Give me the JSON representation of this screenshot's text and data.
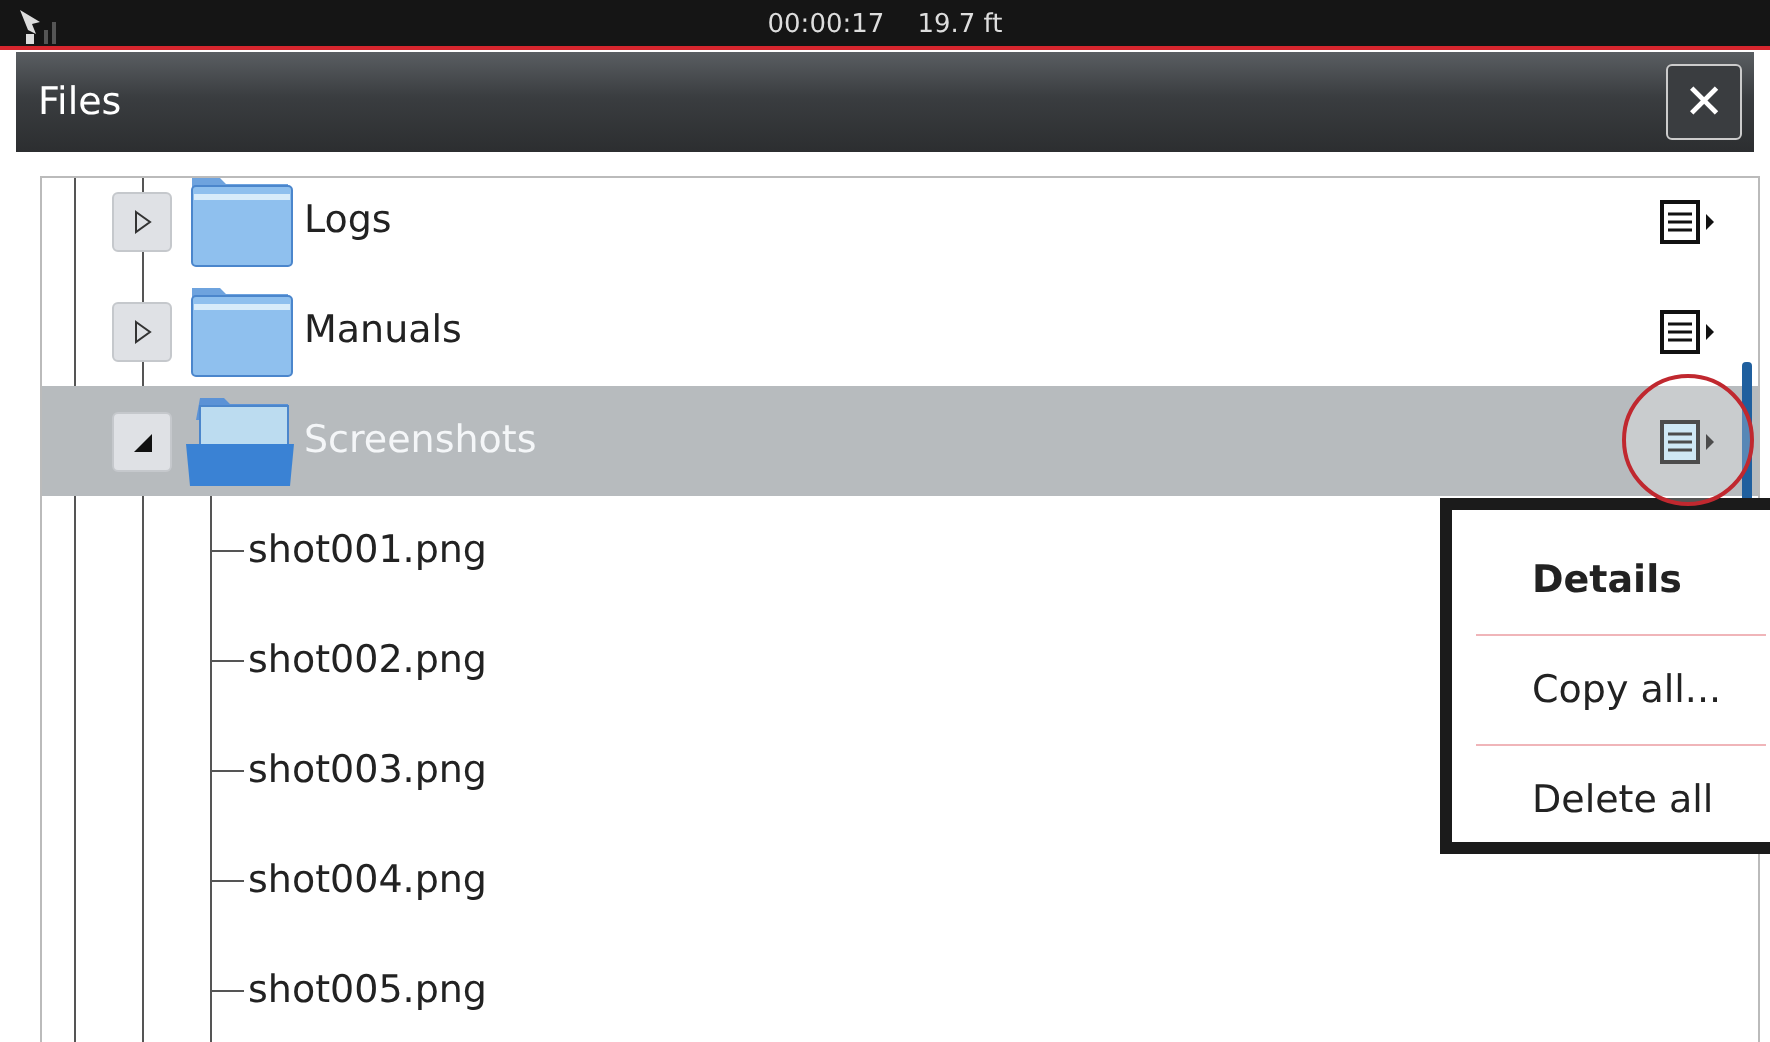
{
  "status_bar": {
    "time": "00:00:17",
    "depth": "19.7 ft"
  },
  "window": {
    "title": "Files",
    "close": "✕"
  },
  "tree": [
    {
      "kind": "folder",
      "label": "Logs",
      "expanded": false,
      "selected": false,
      "callout": false
    },
    {
      "kind": "folder",
      "label": "Manuals",
      "expanded": false,
      "selected": false,
      "callout": false
    },
    {
      "kind": "folder",
      "label": "Screenshots",
      "expanded": true,
      "selected": true,
      "callout": true,
      "children": [
        {
          "kind": "file",
          "label": "shot001.png"
        },
        {
          "kind": "file",
          "label": "shot002.png"
        },
        {
          "kind": "file",
          "label": "shot003.png"
        },
        {
          "kind": "file",
          "label": "shot004.png"
        },
        {
          "kind": "file",
          "label": "shot005.png"
        }
      ]
    }
  ],
  "context_menu": {
    "items": [
      {
        "label": "Details",
        "default": true
      },
      {
        "label": "Copy all...",
        "default": false
      },
      {
        "label": "Delete all",
        "default": false
      }
    ]
  }
}
